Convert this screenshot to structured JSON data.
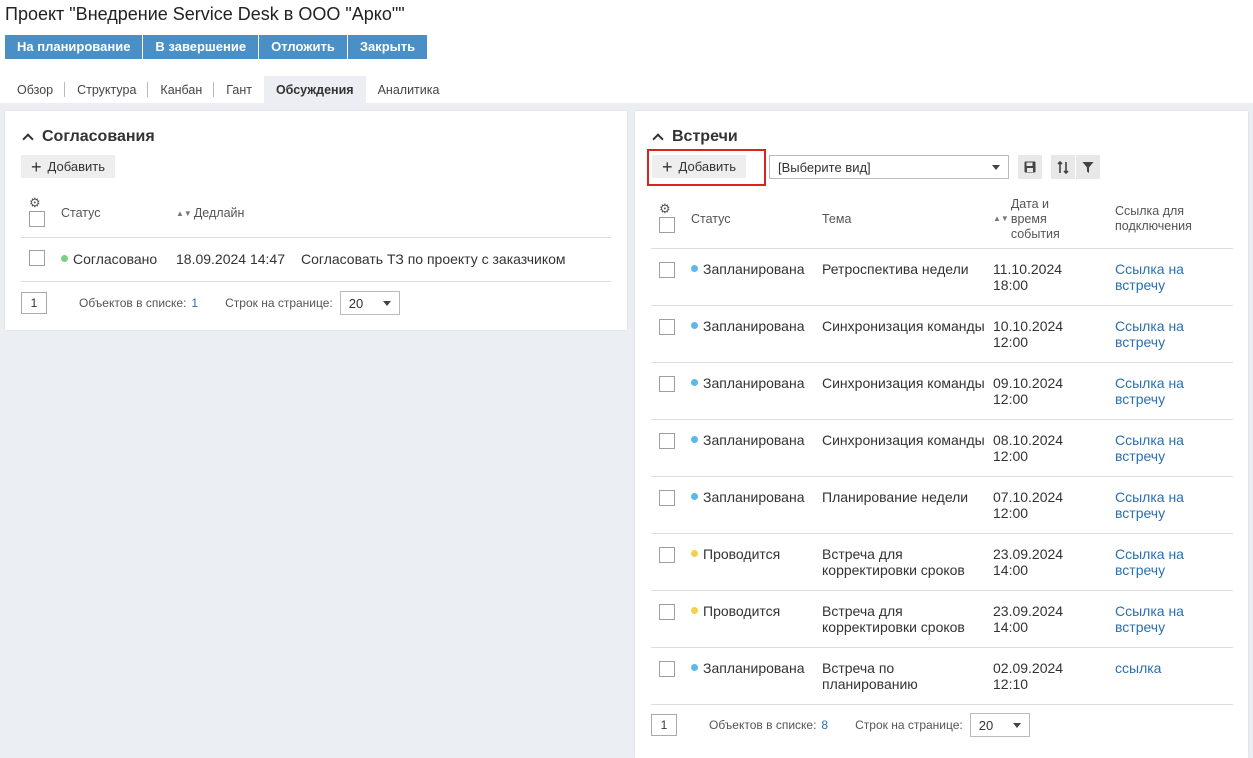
{
  "page": {
    "title": "Проект \"Внедрение Service Desk в ООО \"Арко\"\""
  },
  "actions": [
    "На планирование",
    "В завершение",
    "Отложить",
    "Закрыть"
  ],
  "tabs": [
    "Обзор",
    "Структура",
    "Канбан",
    "Гант",
    "Обсуждения",
    "Аналитика"
  ],
  "active_tab": "Обсуждения",
  "colors": {
    "accent": "#4a90c6",
    "link": "#2a6fb1",
    "status_green": "#7dd07d",
    "status_blue": "#5bb8ea",
    "status_yellow": "#f2d24a",
    "highlight": "#d9231f"
  },
  "approvals": {
    "title": "Согласования",
    "add_label": "Добавить",
    "columns": {
      "status": "Статус",
      "deadline": "Дедлайн"
    },
    "rows": [
      {
        "status": "Согласовано",
        "status_color": "green",
        "deadline": "18.09.2024 14:47",
        "subject": "Согласовать ТЗ по проекту с заказчиком"
      }
    ],
    "pager": {
      "page": "1",
      "count_label": "Объектов в списке:",
      "count": "1",
      "per_page_label": "Строк на странице:",
      "per_page": "20"
    }
  },
  "meetings": {
    "title": "Встречи",
    "add_label": "Добавить",
    "view_placeholder": "[Выберите вид]",
    "columns": {
      "status": "Статус",
      "topic": "Тема",
      "datetime": "Дата и время события",
      "link": "Ссылка для подключения"
    },
    "rows": [
      {
        "status": "Запланирована",
        "status_color": "blue",
        "topic": "Ретроспектива недели",
        "date": "11.10.2024",
        "time": "18:00",
        "link": "Ссылка на встречу"
      },
      {
        "status": "Запланирована",
        "status_color": "blue",
        "topic": "Синхронизация команды",
        "date": "10.10.2024",
        "time": "12:00",
        "link": "Ссылка на встречу"
      },
      {
        "status": "Запланирована",
        "status_color": "blue",
        "topic": "Синхронизация команды",
        "date": "09.10.2024",
        "time": "12:00",
        "link": "Ссылка на встречу"
      },
      {
        "status": "Запланирована",
        "status_color": "blue",
        "topic": "Синхронизация команды",
        "date": "08.10.2024",
        "time": "12:00",
        "link": "Ссылка на встречу"
      },
      {
        "status": "Запланирована",
        "status_color": "blue",
        "topic": "Планирование недели",
        "date": "07.10.2024",
        "time": "12:00",
        "link": "Ссылка на встречу"
      },
      {
        "status": "Проводится",
        "status_color": "yellow",
        "topic": "Встреча для корректировки сроков",
        "date": "23.09.2024",
        "time": "14:00",
        "link": "Ссылка на встречу"
      },
      {
        "status": "Проводится",
        "status_color": "yellow",
        "topic": "Встреча для корректировки сроков",
        "date": "23.09.2024",
        "time": "14:00",
        "link": "Ссылка на встречу"
      },
      {
        "status": "Запланирована",
        "status_color": "blue",
        "topic": "Встреча по планированию",
        "date": "02.09.2024",
        "time": "12:10",
        "link": "ссылка"
      }
    ],
    "pager": {
      "page": "1",
      "count_label": "Объектов в списке:",
      "count": "8",
      "per_page_label": "Строк на странице:",
      "per_page": "20"
    }
  }
}
